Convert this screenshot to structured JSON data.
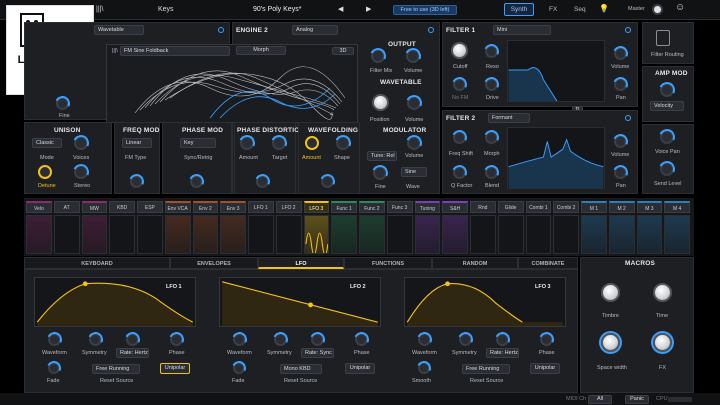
{
  "topbar": {
    "menu_icon": "|||\\",
    "preset_type": "Keys",
    "preset_name": "90's Poly Keys*",
    "prev_arrow": "◀",
    "next_arrow": "▶",
    "save_banner": "Free to use (3D left)",
    "tabs": [
      "Synth",
      "FX",
      "Seq"
    ],
    "master_label": "Master"
  },
  "logo": {
    "line1": "LUIS FERNZ",
    "line2": "STUDIO"
  },
  "engine1": {
    "type": "Wavetable",
    "fine_label": "Fine"
  },
  "engine2": {
    "title": "ENGINE 2",
    "type": "Analog",
    "wavetable_menu": "|||\\",
    "wavetable_name": "FM Sine Foldback",
    "morph": "Morph",
    "toggle": "3D"
  },
  "output": {
    "title": "OUTPUT",
    "filter_mix": "Filter Mix",
    "volume": "Volume"
  },
  "wavetable": {
    "title": "WAVETABLE",
    "position": "Position",
    "volume": "Volume"
  },
  "modulator": {
    "title": "MODULATOR",
    "mode": "Tune: Rel",
    "volume": "Volume",
    "fine": "Fine",
    "wave": "Wave",
    "wave_value": "Sine"
  },
  "unison": {
    "title": "UNISON",
    "mode_value": "Classic",
    "mode": "Mode",
    "voices": "Voices",
    "detune": "Detune",
    "stereo": "Stereo"
  },
  "freq_mod": {
    "title": "FREQ MOD",
    "type_value": "Linear",
    "type": "FM Type"
  },
  "phase_mod": {
    "title": "PHASE MOD",
    "value": "Key",
    "label": "Sync/Retrig"
  },
  "phase_distortion": {
    "title": "PHASE DISTORTION",
    "amount": "Amount",
    "target": "Target"
  },
  "wavefolding": {
    "title": "WAVEFOLDING",
    "amount": "Amount",
    "shape": "Shape"
  },
  "filter1": {
    "title": "FILTER 1",
    "type": "Mini",
    "cutoff": "Cutoff",
    "reso": "Reso",
    "nofm": "No FM",
    "drive": "Drive",
    "volume": "Volume",
    "pan": "Pan"
  },
  "filter2": {
    "title": "FILTER 2",
    "type": "Formant",
    "freq_shift": "Freq Shift",
    "morph": "Morph",
    "q_factor": "Q Factor",
    "blend": "Blend",
    "volume": "Volume",
    "pan": "Pan"
  },
  "right": {
    "filter_routing": "Filter Routing",
    "amp_mod": "AMP MOD",
    "velocity": "Velocity",
    "voice_pan": "Voice Pan",
    "send_level": "Send Level"
  },
  "mod_slots": [
    "Velo",
    "AT",
    "MW",
    "KBD",
    "ESP",
    "Env VCA",
    "Env 2",
    "Env 3",
    "LFO 1",
    "LFO 2",
    "LFO 3",
    "Func 1",
    "Func 2",
    "Func 3",
    "Tuning",
    "S&H",
    "Rnd",
    "Glide",
    "Combi 1",
    "Combi 2",
    "M 1",
    "M 2",
    "M 3",
    "M 4"
  ],
  "section_tabs": [
    "KEYBOARD",
    "ENVELOPES",
    "LFO",
    "FUNCTIONS",
    "RANDOM",
    "COMBINATE",
    "MACROS"
  ],
  "lfos": [
    {
      "name": "LFO 1",
      "waveform": "Waveform",
      "symmetry": "Symmetry",
      "rate_mode": "Rate: Hertz",
      "phase": "Phase",
      "retrig": "Free Running",
      "reset": "Reset Source",
      "fade": "Fade",
      "polarity": "Unipolar"
    },
    {
      "name": "LFO 2",
      "waveform": "Waveform",
      "symmetry": "Symmetry",
      "rate_mode": "Rate: Sync",
      "phase": "Phase",
      "retrig": "Mono KBD",
      "reset": "Reset Source",
      "fade": "Fade",
      "polarity": "Unipolar"
    },
    {
      "name": "LFO 3",
      "waveform": "Waveform",
      "symmetry": "Symmetry",
      "rate_mode": "Rate: Hertz",
      "phase": "Phase",
      "retrig": "Free Running",
      "reset": "Reset Source",
      "fade": "Smooth",
      "polarity": "Unipolar"
    }
  ],
  "macros": {
    "title": "MACROS",
    "m1": "Timbre",
    "m2": "Time",
    "m3": "Space width",
    "m4": "FX"
  },
  "footer": {
    "midi": "MIDI Ch",
    "all": "All",
    "panic": "Panic",
    "cpu": "CPU"
  }
}
